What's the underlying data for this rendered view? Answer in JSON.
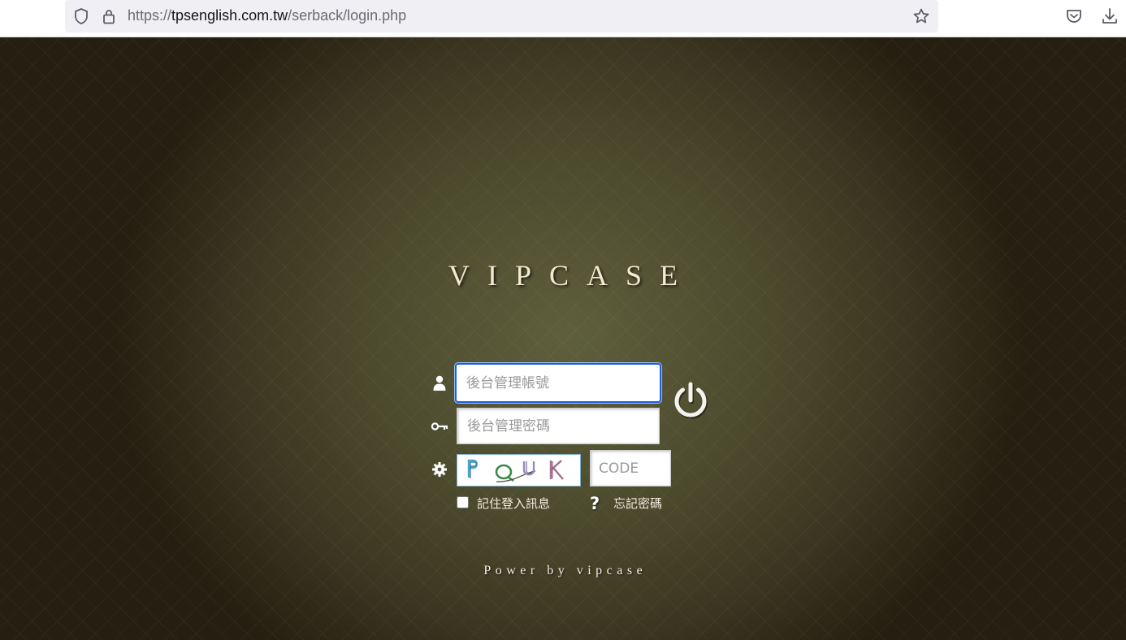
{
  "browser": {
    "url_prefix": "https://",
    "url_host": "tpsenglish.com.tw",
    "url_path": "/serback/login.php"
  },
  "login": {
    "brand": "VIPCASE",
    "username_placeholder": "後台管理帳號",
    "password_placeholder": "後台管理密碼",
    "captcha_image_text": "PQUK",
    "code_placeholder": "CODE",
    "remember_label": "記住登入訊息",
    "help_symbol": "?",
    "forgot_label": "忘記密碼",
    "footer": "Power by vipcase"
  },
  "colors": {
    "background_center": "#5e5f3d",
    "background_edge": "#241f10",
    "focus_ring": "#1a5fe0"
  },
  "icons": {
    "user_row": "user-icon",
    "password_row": "key-icon",
    "captcha_row": "gear-icon",
    "submit": "power-icon"
  }
}
